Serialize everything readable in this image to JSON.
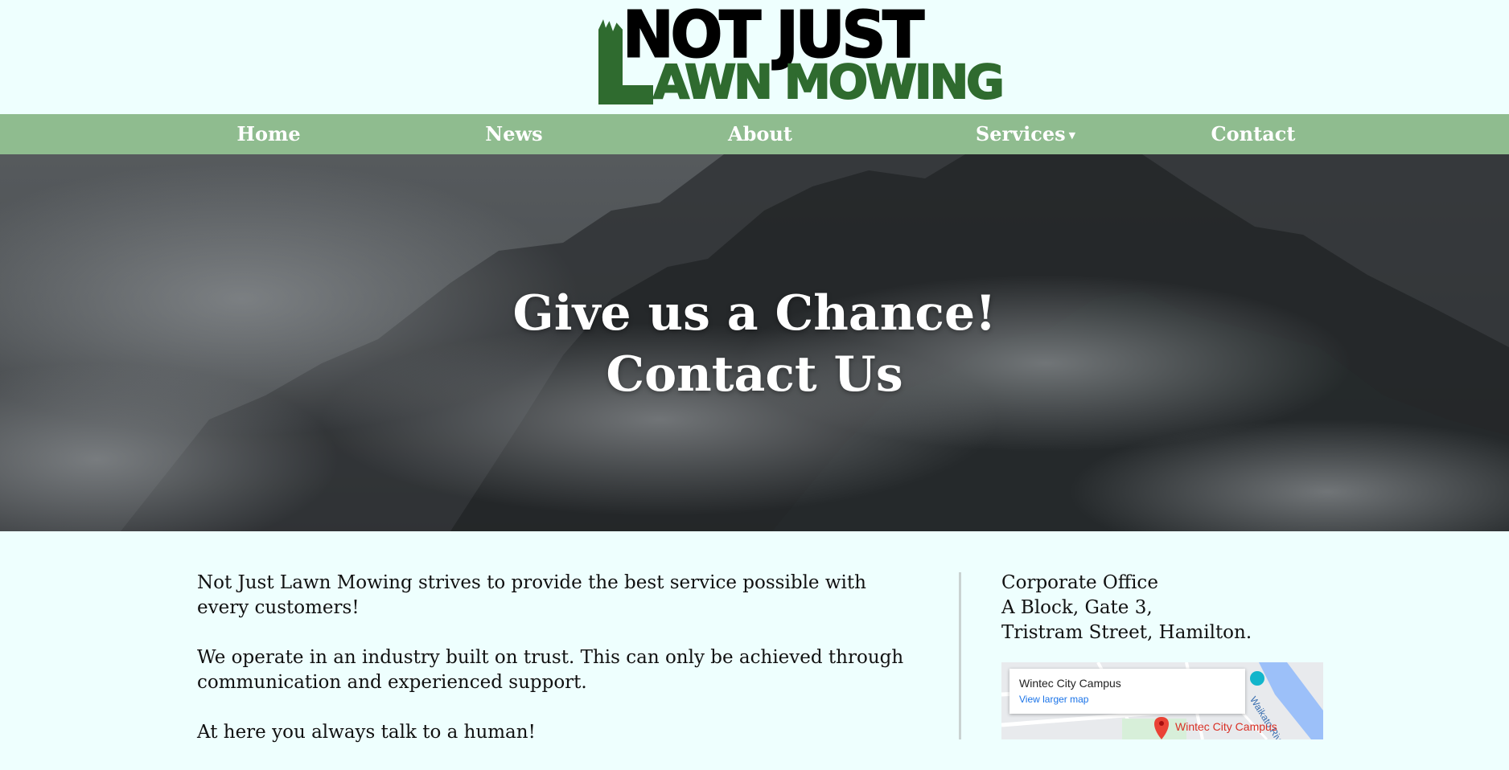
{
  "logo": {
    "line1": "NOT JUST",
    "line2": "AWN MOWING"
  },
  "nav": {
    "items": [
      {
        "label": "Home"
      },
      {
        "label": "News"
      },
      {
        "label": "About"
      },
      {
        "label": "Services",
        "has_dropdown": true
      },
      {
        "label": "Contact"
      }
    ]
  },
  "hero": {
    "line1": "Give us a Chance!",
    "line2": "Contact Us"
  },
  "main": {
    "paragraphs": [
      "Not Just Lawn Mowing strives to provide the best service possible with every customers!",
      "We operate in an industry built on trust. This can only be achieved through communication and experienced support.",
      "At here you always talk to a human!"
    ]
  },
  "office": {
    "lines": [
      "Corporate Office",
      "A Block, Gate 3,",
      "Tristram Street, Hamilton."
    ]
  },
  "map": {
    "card_title": "Wintec City Campus",
    "card_link": "View larger map",
    "marker_label": "Wintec City Campus",
    "river_label": "Waikato River"
  },
  "colors": {
    "page_bg": "#eefffe",
    "nav_bg": "#8fbc8f",
    "logo_green": "#2f6b2f"
  }
}
